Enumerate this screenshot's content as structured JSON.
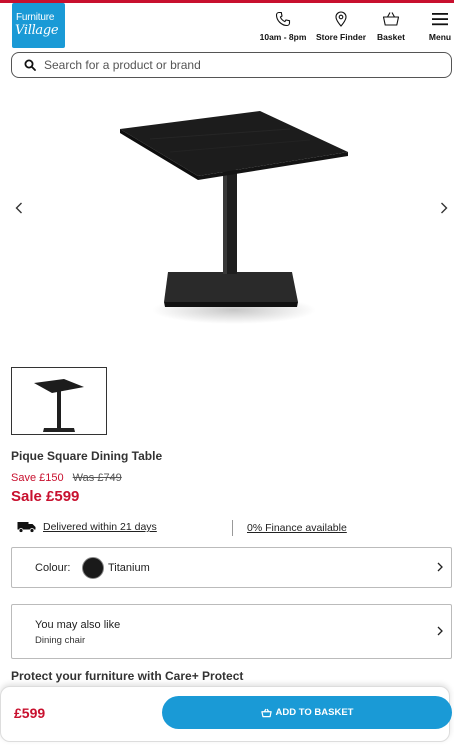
{
  "brand": {
    "logo_line1": "Furniture",
    "logo_line2": "Village",
    "color": "#1a9ad6",
    "accent": "#c8102e"
  },
  "header": {
    "nav": [
      {
        "label": "10am - 8pm",
        "icon": "phone-icon"
      },
      {
        "label": "Store Finder",
        "icon": "location-pin-icon"
      },
      {
        "label": "Basket",
        "icon": "basket-icon"
      },
      {
        "label": "Menu",
        "icon": "hamburger-menu-icon"
      }
    ]
  },
  "search": {
    "placeholder": "Search for a product or brand",
    "value": ""
  },
  "product": {
    "title": "Pique Square Dining Table",
    "save": "Save £150",
    "was": "Was £749",
    "sale": "Sale £599",
    "delivery": "Delivered within 21 days",
    "finance": "0% Finance available",
    "colour_label": "Colour:",
    "colour_value": "Titanium",
    "swatch_color": "#1a1a1a"
  },
  "also_like": {
    "heading": "You may also like",
    "sub": "Dining chair"
  },
  "protect": {
    "heading": "Protect your furniture with Care+ Protect"
  },
  "bottom_bar": {
    "price": "£599",
    "button": "ADD TO BASKET"
  }
}
